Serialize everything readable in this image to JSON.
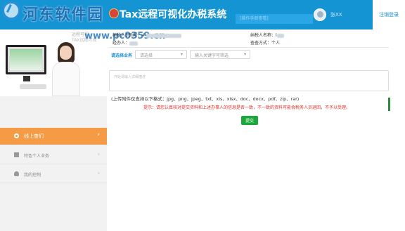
{
  "watermark": {
    "title": "河东软件园",
    "url": "www.pc0359.cn"
  },
  "header": {
    "app_title": "Tax远程可视化办税系统",
    "tab_strip": "[操作手册查看]",
    "user_name": "张XX",
    "logout_label": "注销登录"
  },
  "banner": {
    "line1": "远程可视",
    "line2": "TAX远程可视"
  },
  "taxpayer": {
    "id_label": "纳税人识别号：",
    "id_value": "4",
    "name_label": "纳税人名称：",
    "name_value": "l",
    "handler_label": "经办人：",
    "handler_value": "",
    "method_label": "查查方式：",
    "method_value": "个人"
  },
  "business": {
    "label": "请选择业务",
    "select_placeholder": "请选择",
    "search_placeholder": "输入关键字可筛选"
  },
  "description": {
    "placeholder": "开始请输入详细描述"
  },
  "format_note": "(上传附件仅支持以下格式：jpg、png、jpeg、txt、xls、xlsx、doc、docx、pdf、zip、rar)",
  "warning": "提示：请您认真核对提交资料和上述办事人的信息是否一致，不一致的资料可能会税务人员退回，不予以受理。",
  "submit_label": "提交",
  "nav": {
    "items": [
      {
        "label": "线上查们",
        "active": true
      },
      {
        "label": "特色个人业务",
        "active": false
      },
      {
        "label": "我的控制",
        "active": false
      }
    ]
  },
  "colors": {
    "header": "#1594d4",
    "accent": "#f59a45",
    "submit": "#1aa83a",
    "warning": "#e0302a"
  }
}
